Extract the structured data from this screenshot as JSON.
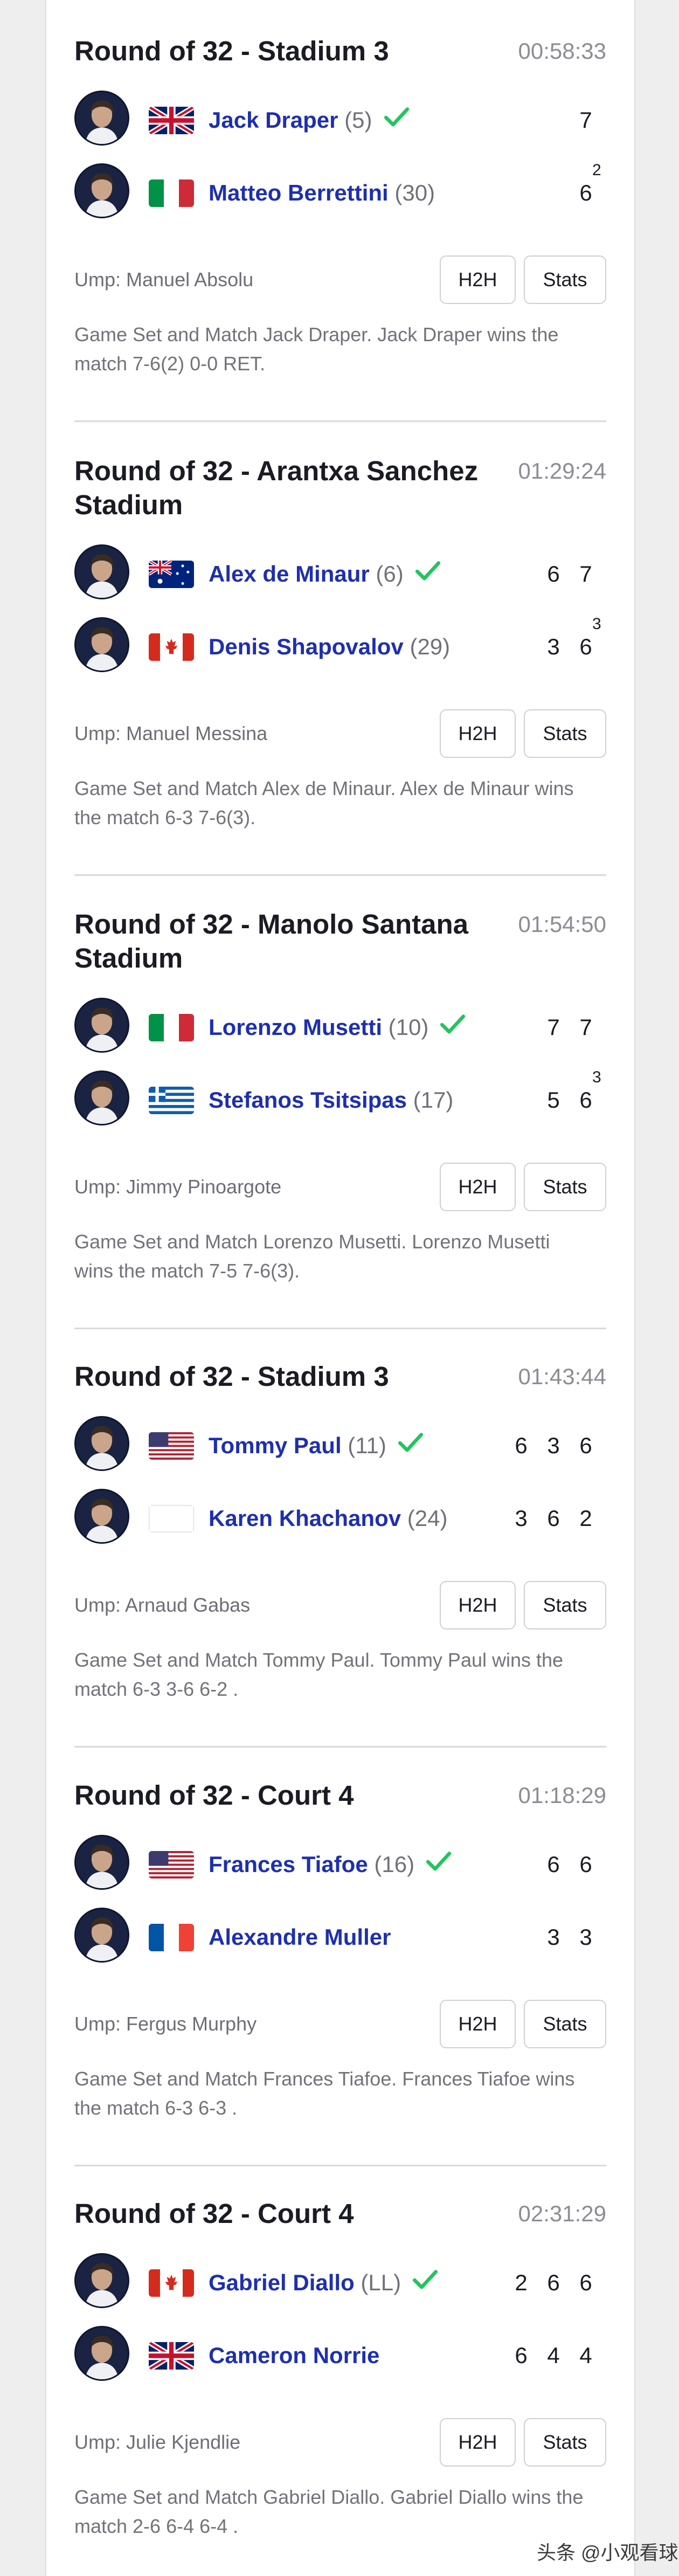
{
  "matches": [
    {
      "round": "Round of 32 - Stadium 3",
      "duration": "00:58:33",
      "umpire": "Ump: Manuel Absolu",
      "h2h_label": "H2H",
      "stats_label": "Stats",
      "summary": "Game Set and Match Jack Draper. Jack Draper wins the match 7-6(2) 0-0 RET.",
      "players": [
        {
          "name": "Jack Draper",
          "seed": "(5)",
          "flag": "uk-flag",
          "winner": true,
          "scores": [
            "7"
          ],
          "tiebreaks": [
            ""
          ]
        },
        {
          "name": "Matteo Berrettini",
          "seed": "(30)",
          "flag": "italy-flag",
          "winner": false,
          "scores": [
            "6"
          ],
          "tiebreaks": [
            "2"
          ]
        }
      ]
    },
    {
      "round": "Round of 32 - Arantxa Sanchez Stadium",
      "duration": "01:29:24",
      "umpire": "Ump: Manuel Messina",
      "h2h_label": "H2H",
      "stats_label": "Stats",
      "summary": "Game Set and Match Alex de Minaur. Alex de Minaur wins the match 6-3 7-6(3).",
      "players": [
        {
          "name": "Alex de Minaur",
          "seed": "(6)",
          "flag": "australia-flag",
          "winner": true,
          "scores": [
            "6",
            "7"
          ],
          "tiebreaks": [
            "",
            ""
          ]
        },
        {
          "name": "Denis Shapovalov",
          "seed": "(29)",
          "flag": "canada-flag",
          "winner": false,
          "scores": [
            "3",
            "6"
          ],
          "tiebreaks": [
            "",
            "3"
          ]
        }
      ]
    },
    {
      "round": "Round of 32 - Manolo Santana Stadium",
      "duration": "01:54:50",
      "umpire": "Ump: Jimmy Pinoargote",
      "h2h_label": "H2H",
      "stats_label": "Stats",
      "summary": "Game Set and Match Lorenzo Musetti. Lorenzo Musetti wins the match 7-5 7-6(3).",
      "players": [
        {
          "name": "Lorenzo Musetti",
          "seed": "(10)",
          "flag": "italy-flag",
          "winner": true,
          "scores": [
            "7",
            "7"
          ],
          "tiebreaks": [
            "",
            ""
          ]
        },
        {
          "name": "Stefanos Tsitsipas",
          "seed": "(17)",
          "flag": "greece-flag",
          "winner": false,
          "scores": [
            "5",
            "6"
          ],
          "tiebreaks": [
            "",
            "3"
          ]
        }
      ]
    },
    {
      "round": "Round of 32 - Stadium 3",
      "duration": "01:43:44",
      "umpire": "Ump: Arnaud Gabas",
      "h2h_label": "H2H",
      "stats_label": "Stats",
      "summary": "Game Set and Match Tommy Paul. Tommy Paul wins the match 6-3 3-6 6-2 .",
      "players": [
        {
          "name": "Tommy Paul",
          "seed": "(11)",
          "flag": "usa-flag",
          "winner": true,
          "scores": [
            "6",
            "3",
            "6"
          ],
          "tiebreaks": [
            "",
            "",
            ""
          ]
        },
        {
          "name": "Karen Khachanov",
          "seed": "(24)",
          "flag": "blank-flag",
          "winner": false,
          "scores": [
            "3",
            "6",
            "2"
          ],
          "tiebreaks": [
            "",
            "",
            ""
          ]
        }
      ]
    },
    {
      "round": "Round of 32 - Court 4",
      "duration": "01:18:29",
      "umpire": "Ump: Fergus Murphy",
      "h2h_label": "H2H",
      "stats_label": "Stats",
      "summary": "Game Set and Match Frances Tiafoe. Frances Tiafoe wins the match 6-3 6-3 .",
      "players": [
        {
          "name": "Frances Tiafoe",
          "seed": "(16)",
          "flag": "usa-flag",
          "winner": true,
          "scores": [
            "6",
            "6"
          ],
          "tiebreaks": [
            "",
            ""
          ]
        },
        {
          "name": "Alexandre Muller",
          "seed": "",
          "flag": "france-flag",
          "winner": false,
          "scores": [
            "3",
            "3"
          ],
          "tiebreaks": [
            "",
            ""
          ]
        }
      ]
    },
    {
      "round": "Round of 32 - Court 4",
      "duration": "02:31:29",
      "umpire": "Ump: Julie Kjendlie",
      "h2h_label": "H2H",
      "stats_label": "Stats",
      "summary": "Game Set and Match Gabriel Diallo. Gabriel Diallo wins the match 2-6 6-4 6-4 .",
      "players": [
        {
          "name": "Gabriel Diallo",
          "seed": "(LL)",
          "flag": "canada-flag",
          "winner": true,
          "scores": [
            "2",
            "6",
            "6"
          ],
          "tiebreaks": [
            "",
            "",
            ""
          ]
        },
        {
          "name": "Cameron Norrie",
          "seed": "",
          "flag": "uk-flag",
          "winner": false,
          "scores": [
            "6",
            "4",
            "4"
          ],
          "tiebreaks": [
            "",
            "",
            ""
          ]
        }
      ]
    }
  ],
  "watermark": "头条 @小观看球",
  "colors": {
    "name": "#1e2fae",
    "check": "#22c55e",
    "divider": "#d9d9de"
  }
}
